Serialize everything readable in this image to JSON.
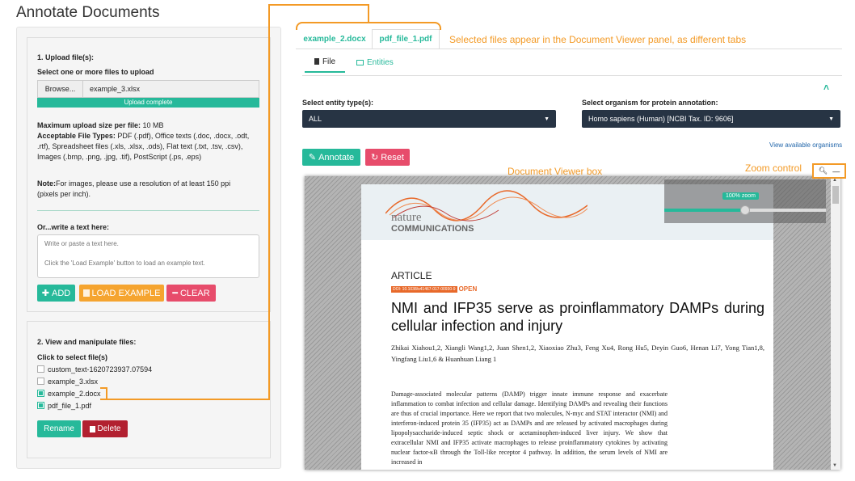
{
  "title": "Annotate Documents",
  "upload": {
    "heading": "1. Upload file(s):",
    "select_label": "Select one or more files to upload",
    "browse": "Browse...",
    "file_value": "example_3.xlsx",
    "progress": "Upload complete",
    "max_size_label": "Maximum upload size per file:",
    "max_size": " 10 MB",
    "types_label": "Acceptable File Types:",
    "types": " PDF (.pdf), Office texts (.doc, .docx, .odt, .rtf), Spreadsheet files (.xls, .xlsx, .ods), Flat text (.txt, .tsv, .csv), Images (.bmp, .png, .jpg, .tif), PostScript (.ps, .eps)",
    "note_label": "Note:",
    "note": "For images, please use a resolution of at least 150 ppi (pixels per inch).",
    "write_label": "Or...write a text here:",
    "text_placeholder": "Write or paste a text here.\n\nClick the 'Load Example' button to load an example text.",
    "add": "ADD",
    "load": "LOAD EXAMPLE",
    "clear": "CLEAR"
  },
  "view": {
    "heading": "2. View and manipulate files:",
    "click_label": "Click to select file(s)",
    "files": [
      {
        "name": "custom_text-1620723937.07594",
        "checked": false
      },
      {
        "name": "example_3.xlsx",
        "checked": false
      },
      {
        "name": "example_2.docx",
        "checked": true
      },
      {
        "name": "pdf_file_1.pdf",
        "checked": true
      }
    ],
    "rename": "Rename",
    "delete": "Delete"
  },
  "tabs": [
    "example_2.docx",
    "pdf_file_1.pdf"
  ],
  "subtabs": [
    "File",
    "Entities"
  ],
  "entity_label": "Select entity type(s):",
  "entity_value": "ALL",
  "organism_label": "Select organism for protein annotation:",
  "organism_value": "Homo sapiens (Human) [NCBI Tax. ID: 9606]",
  "view_orgs": "View available organisms",
  "annotate": "Annotate",
  "reset": "Reset",
  "annotations": {
    "tabs_note": "Selected files appear in the Document Viewer panel, as different tabs",
    "viewer_note": "Document Viewer box",
    "zoom_note": "Zoom control"
  },
  "zoom_label": "100% zoom",
  "zoom_value": 0.5,
  "doc": {
    "logo1": "nature",
    "logo2": "COMMUNICATIONS",
    "kind": "ARTICLE",
    "doi": "DOI: 10.1038/s41467-017-00930-9",
    "open": "OPEN",
    "title": "NMI and IFP35 serve as proinflammatory DAMPs during cellular infection and injury",
    "authors": "Zhikai Xiahou1,2, Xiangli Wang1,2, Juan Shen1,2, Xiaoxiao Zhu3, Feng Xu4, Rong Hu5, Deyin Guo6, Henan Li7, Yong Tian1,8, Yingfang Liu1,6 & Huanhuan Liang 1",
    "abstract": "Damage-associated molecular patterns (DAMP) trigger innate immune response and exacerbate inflammation to combat infection and cellular damage. Identifying DAMPs and revealing their functions are thus of crucial importance. Here we report that two molecules, N-myc and STAT interactor (NMI) and interferon-induced protein 35 (IFP35) act as DAMPs and are released by activated macrophages during lipopolysaccharide-induced septic shock or acetaminophen-induced liver injury. We show that extracellular NMI and IFP35 activate macrophages to release proinflammatory cytokines by activating nuclear factor-κB through the Toll-like receptor 4 pathway. In addition, the serum levels of NMI are increased in"
  },
  "colors": {
    "accent": "#26b99a",
    "annotation": "#f39a26",
    "select_bg": "#273444",
    "danger": "#e74c6b"
  }
}
